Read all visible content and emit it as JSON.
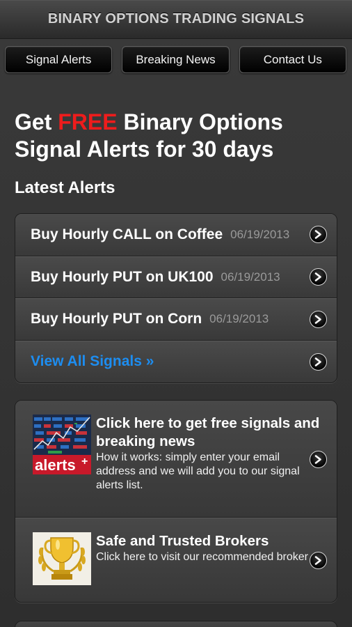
{
  "header": {
    "title": "BINARY OPTIONS TRADING SIGNALS"
  },
  "nav": [
    "Signal Alerts",
    "Breaking News",
    "Contact Us"
  ],
  "hero": {
    "prefix": "Get ",
    "highlight": "FREE",
    "line1_rest": " Binary Options",
    "line2": "Signal Alerts for 30 days",
    "highlight_color": "#ee1c1c"
  },
  "latest": {
    "title": "Latest Alerts",
    "items": [
      {
        "title": "Buy Hourly CALL on Coffee",
        "date": "06/19/2013"
      },
      {
        "title": "Buy Hourly PUT on UK100",
        "date": "06/19/2013"
      },
      {
        "title": "Buy Hourly PUT on Corn",
        "date": "06/19/2013"
      }
    ],
    "view_all": "View All Signals »",
    "link_color": "#1d8df0"
  },
  "promos": [
    {
      "icon": "alerts-chart-icon",
      "badge": "alerts",
      "badge_plus": "+",
      "title": "Click here to get free signals and breaking news",
      "body": "How it works: simply enter your email address and we will add you to our signal alerts list."
    },
    {
      "icon": "trophy-icon",
      "title": "Safe and Trusted Brokers",
      "body": "Click here to visit our recommended broker"
    }
  ]
}
